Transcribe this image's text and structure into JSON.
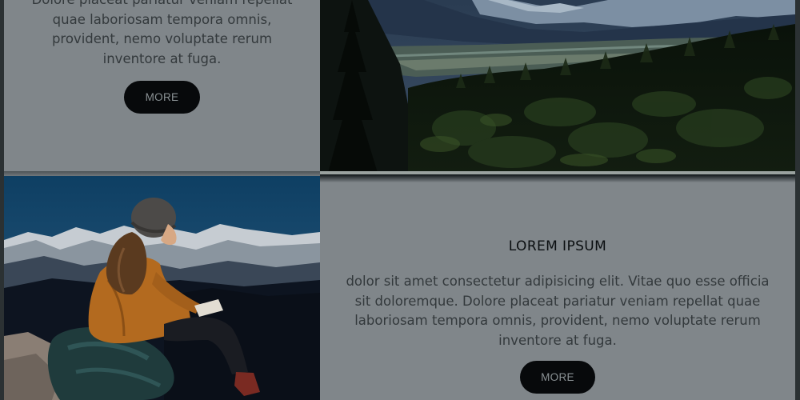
{
  "top_card": {
    "body_text": "Dolore placeat pariatur veniam repellat quae laboriosam tempora omnis, provident, nemo voluptate rerum inventore at fuga.",
    "button_label": "MORE",
    "image": "mountain-valley-forest-photo"
  },
  "bottom_card": {
    "image": "hiker-woman-reading-mountains-photo",
    "heading": "LOREM IPSUM",
    "body_text": "dolor sit amet consectetur adipisicing elit. Vitae quo esse officia sit doloremque. Dolore placeat pariatur veniam repellat quae laboriosam tempora omnis, provident, nemo voluptate rerum inventore at fuga.",
    "button_label": "MORE"
  },
  "colors": {
    "overlay_gray": "#80868a",
    "button_bg": "#07090b",
    "button_text": "#8a9194",
    "body_text": "#33393c",
    "heading_text": "#0b0f11"
  }
}
